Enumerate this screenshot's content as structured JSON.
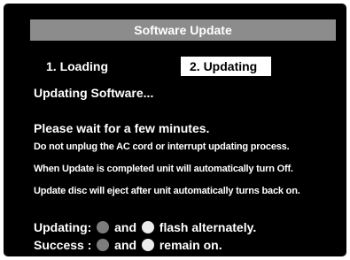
{
  "dialog": {
    "title": "Software Update"
  },
  "steps": [
    {
      "label": "1. Loading",
      "active": false
    },
    {
      "label": "2. Updating",
      "active": true
    }
  ],
  "status": "Updating Software...",
  "instructions": {
    "heading": "Please wait for a few minutes.",
    "lines": [
      "Do not unplug the AC cord or interrupt updating process.",
      "When Update is completed unit will automatically turn Off.",
      "Update disc will eject after unit automatically turns back on."
    ]
  },
  "legend": {
    "updating": {
      "label": "Updating:",
      "joiner": "and",
      "text": "flash alternately."
    },
    "success": {
      "label": "Success :",
      "joiner": "and",
      "text": "remain on."
    }
  },
  "colors": {
    "background": "#000000",
    "title_bar": "#8c8c8c",
    "indicator_dark": "#7c7c7c",
    "indicator_light": "#ececec"
  }
}
